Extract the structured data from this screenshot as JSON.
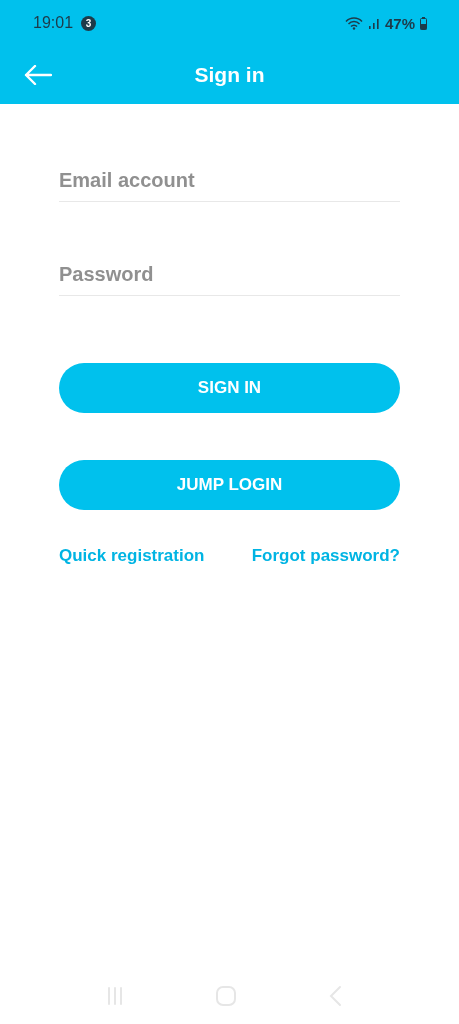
{
  "status_bar": {
    "time": "19:01",
    "notification_count": "3",
    "battery": "47%"
  },
  "header": {
    "title": "Sign in"
  },
  "fields": [
    {
      "placeholder": "Email account"
    },
    {
      "placeholder": "Password"
    }
  ],
  "buttons": [
    "SIGN IN",
    "JUMP LOGIN"
  ],
  "links": [
    "Quick registration",
    "Forgot password?"
  ]
}
